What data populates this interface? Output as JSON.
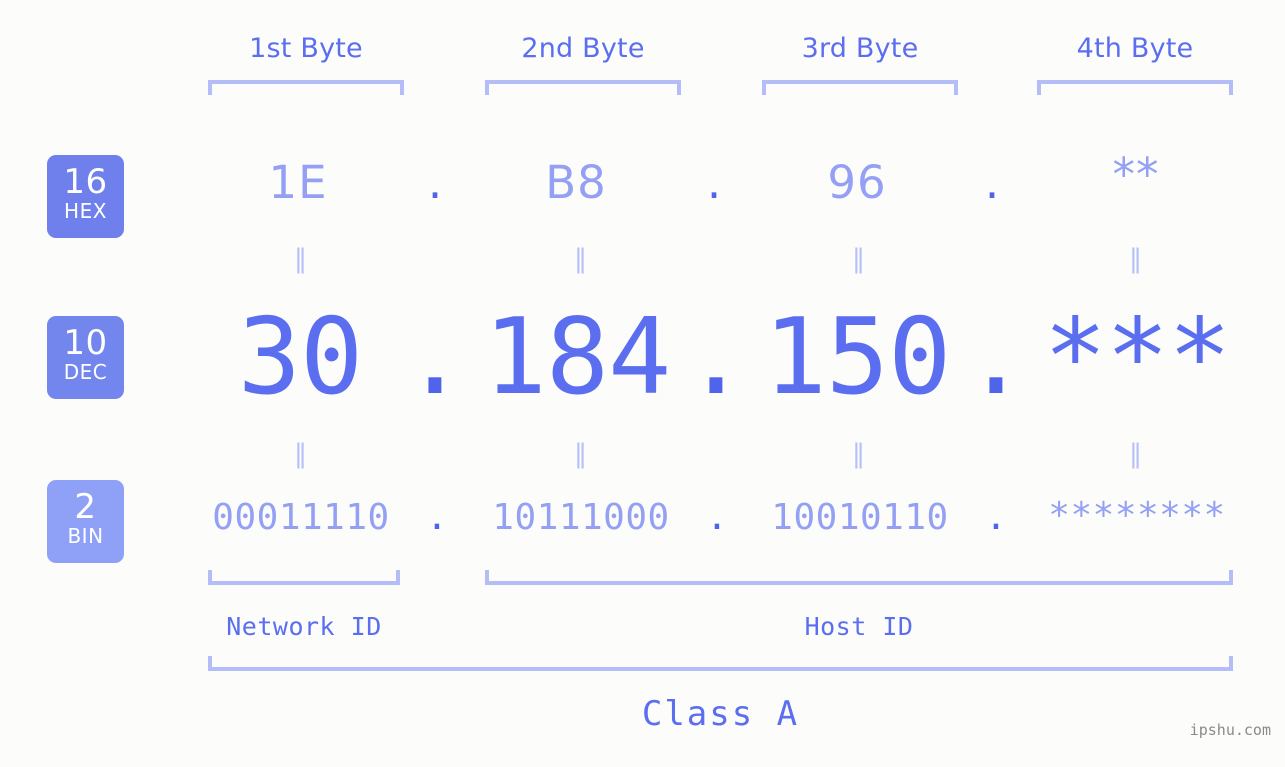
{
  "background_color": "#fcfdfa",
  "accent_color": "#5b6ef0",
  "light_accent_color": "#93a0f4",
  "bracket_color": "#b4bdf7",
  "equals_color": "#b8c0f8",
  "header": {
    "bytes": [
      {
        "label": "1st Byte"
      },
      {
        "label": "2nd Byte"
      },
      {
        "label": "3rd Byte"
      },
      {
        "label": "4th Byte"
      }
    ]
  },
  "bases": [
    {
      "number": "16",
      "name": "HEX",
      "badge_color": "#6f80ec"
    },
    {
      "number": "10",
      "name": "DEC",
      "badge_color": "#7286ee"
    },
    {
      "number": "2",
      "name": "BIN",
      "badge_color": "#8fa1f6"
    }
  ],
  "rows": {
    "hex": {
      "base_number": "16",
      "base_name": "HEX",
      "values": [
        "1E",
        "B8",
        "96",
        "**"
      ],
      "separator": "."
    },
    "dec": {
      "base_number": "10",
      "base_name": "DEC",
      "values": [
        "30",
        "184",
        "150",
        "***"
      ],
      "separator": "."
    },
    "bin": {
      "base_number": "2",
      "base_name": "BIN",
      "values": [
        "00011110",
        "10111000",
        "10010110",
        "********"
      ],
      "separator": "."
    }
  },
  "equals_mark": "‖",
  "segments": {
    "network_id": "Network ID",
    "host_id": "Host ID",
    "class": "Class A"
  },
  "watermark": "ipshu.com"
}
